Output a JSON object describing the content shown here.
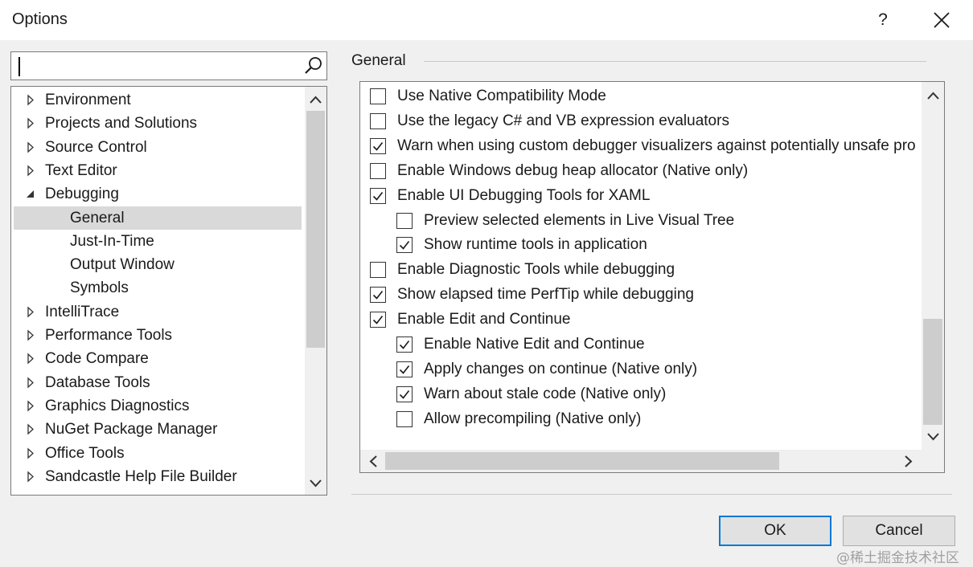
{
  "window": {
    "title": "Options",
    "help_label": "?"
  },
  "search": {
    "value": "",
    "placeholder": ""
  },
  "tree": {
    "items": [
      {
        "label": "Environment",
        "arrow": "collapsed",
        "level": 0
      },
      {
        "label": "Projects and Solutions",
        "arrow": "collapsed",
        "level": 0
      },
      {
        "label": "Source Control",
        "arrow": "collapsed",
        "level": 0
      },
      {
        "label": "Text Editor",
        "arrow": "collapsed",
        "level": 0
      },
      {
        "label": "Debugging",
        "arrow": "expanded",
        "level": 0
      },
      {
        "label": "General",
        "arrow": "none",
        "level": 1,
        "selected": true
      },
      {
        "label": "Just-In-Time",
        "arrow": "none",
        "level": 1
      },
      {
        "label": "Output Window",
        "arrow": "none",
        "level": 1
      },
      {
        "label": "Symbols",
        "arrow": "none",
        "level": 1
      },
      {
        "label": "IntelliTrace",
        "arrow": "collapsed",
        "level": 0
      },
      {
        "label": "Performance Tools",
        "arrow": "collapsed",
        "level": 0
      },
      {
        "label": "Code Compare",
        "arrow": "collapsed",
        "level": 0
      },
      {
        "label": "Database Tools",
        "arrow": "collapsed",
        "level": 0
      },
      {
        "label": "Graphics Diagnostics",
        "arrow": "collapsed",
        "level": 0
      },
      {
        "label": "NuGet Package Manager",
        "arrow": "collapsed",
        "level": 0
      },
      {
        "label": "Office Tools",
        "arrow": "collapsed",
        "level": 0
      },
      {
        "label": "Sandcastle Help File Builder",
        "arrow": "collapsed",
        "level": 0
      }
    ]
  },
  "section": {
    "heading": "General"
  },
  "options": [
    {
      "label": "Use Native Compatibility Mode",
      "checked": false,
      "level": 0
    },
    {
      "label": "Use the legacy C# and VB expression evaluators",
      "checked": false,
      "level": 0
    },
    {
      "label": "Warn when using custom debugger visualizers against potentially unsafe pro",
      "checked": true,
      "level": 0
    },
    {
      "label": "Enable Windows debug heap allocator (Native only)",
      "checked": false,
      "level": 0
    },
    {
      "label": "Enable UI Debugging Tools for XAML",
      "checked": true,
      "level": 0
    },
    {
      "label": "Preview selected elements in Live Visual Tree",
      "checked": false,
      "level": 1
    },
    {
      "label": "Show runtime tools in application",
      "checked": true,
      "level": 1
    },
    {
      "label": "Enable Diagnostic Tools while debugging",
      "checked": false,
      "level": 0
    },
    {
      "label": "Show elapsed time PerfTip while debugging",
      "checked": true,
      "level": 0
    },
    {
      "label": "Enable Edit and Continue",
      "checked": true,
      "level": 0
    },
    {
      "label": "Enable Native Edit and Continue",
      "checked": true,
      "level": 1
    },
    {
      "label": "Apply changes on continue (Native only)",
      "checked": true,
      "level": 1
    },
    {
      "label": "Warn about stale code (Native only)",
      "checked": true,
      "level": 1
    },
    {
      "label": "Allow precompiling (Native only)",
      "checked": false,
      "level": 1
    }
  ],
  "buttons": {
    "ok": "OK",
    "cancel": "Cancel"
  },
  "watermark": "@稀土掘金技术社区",
  "colors": {
    "accent": "#0078d7",
    "selected_row": "#d9d9d9"
  }
}
